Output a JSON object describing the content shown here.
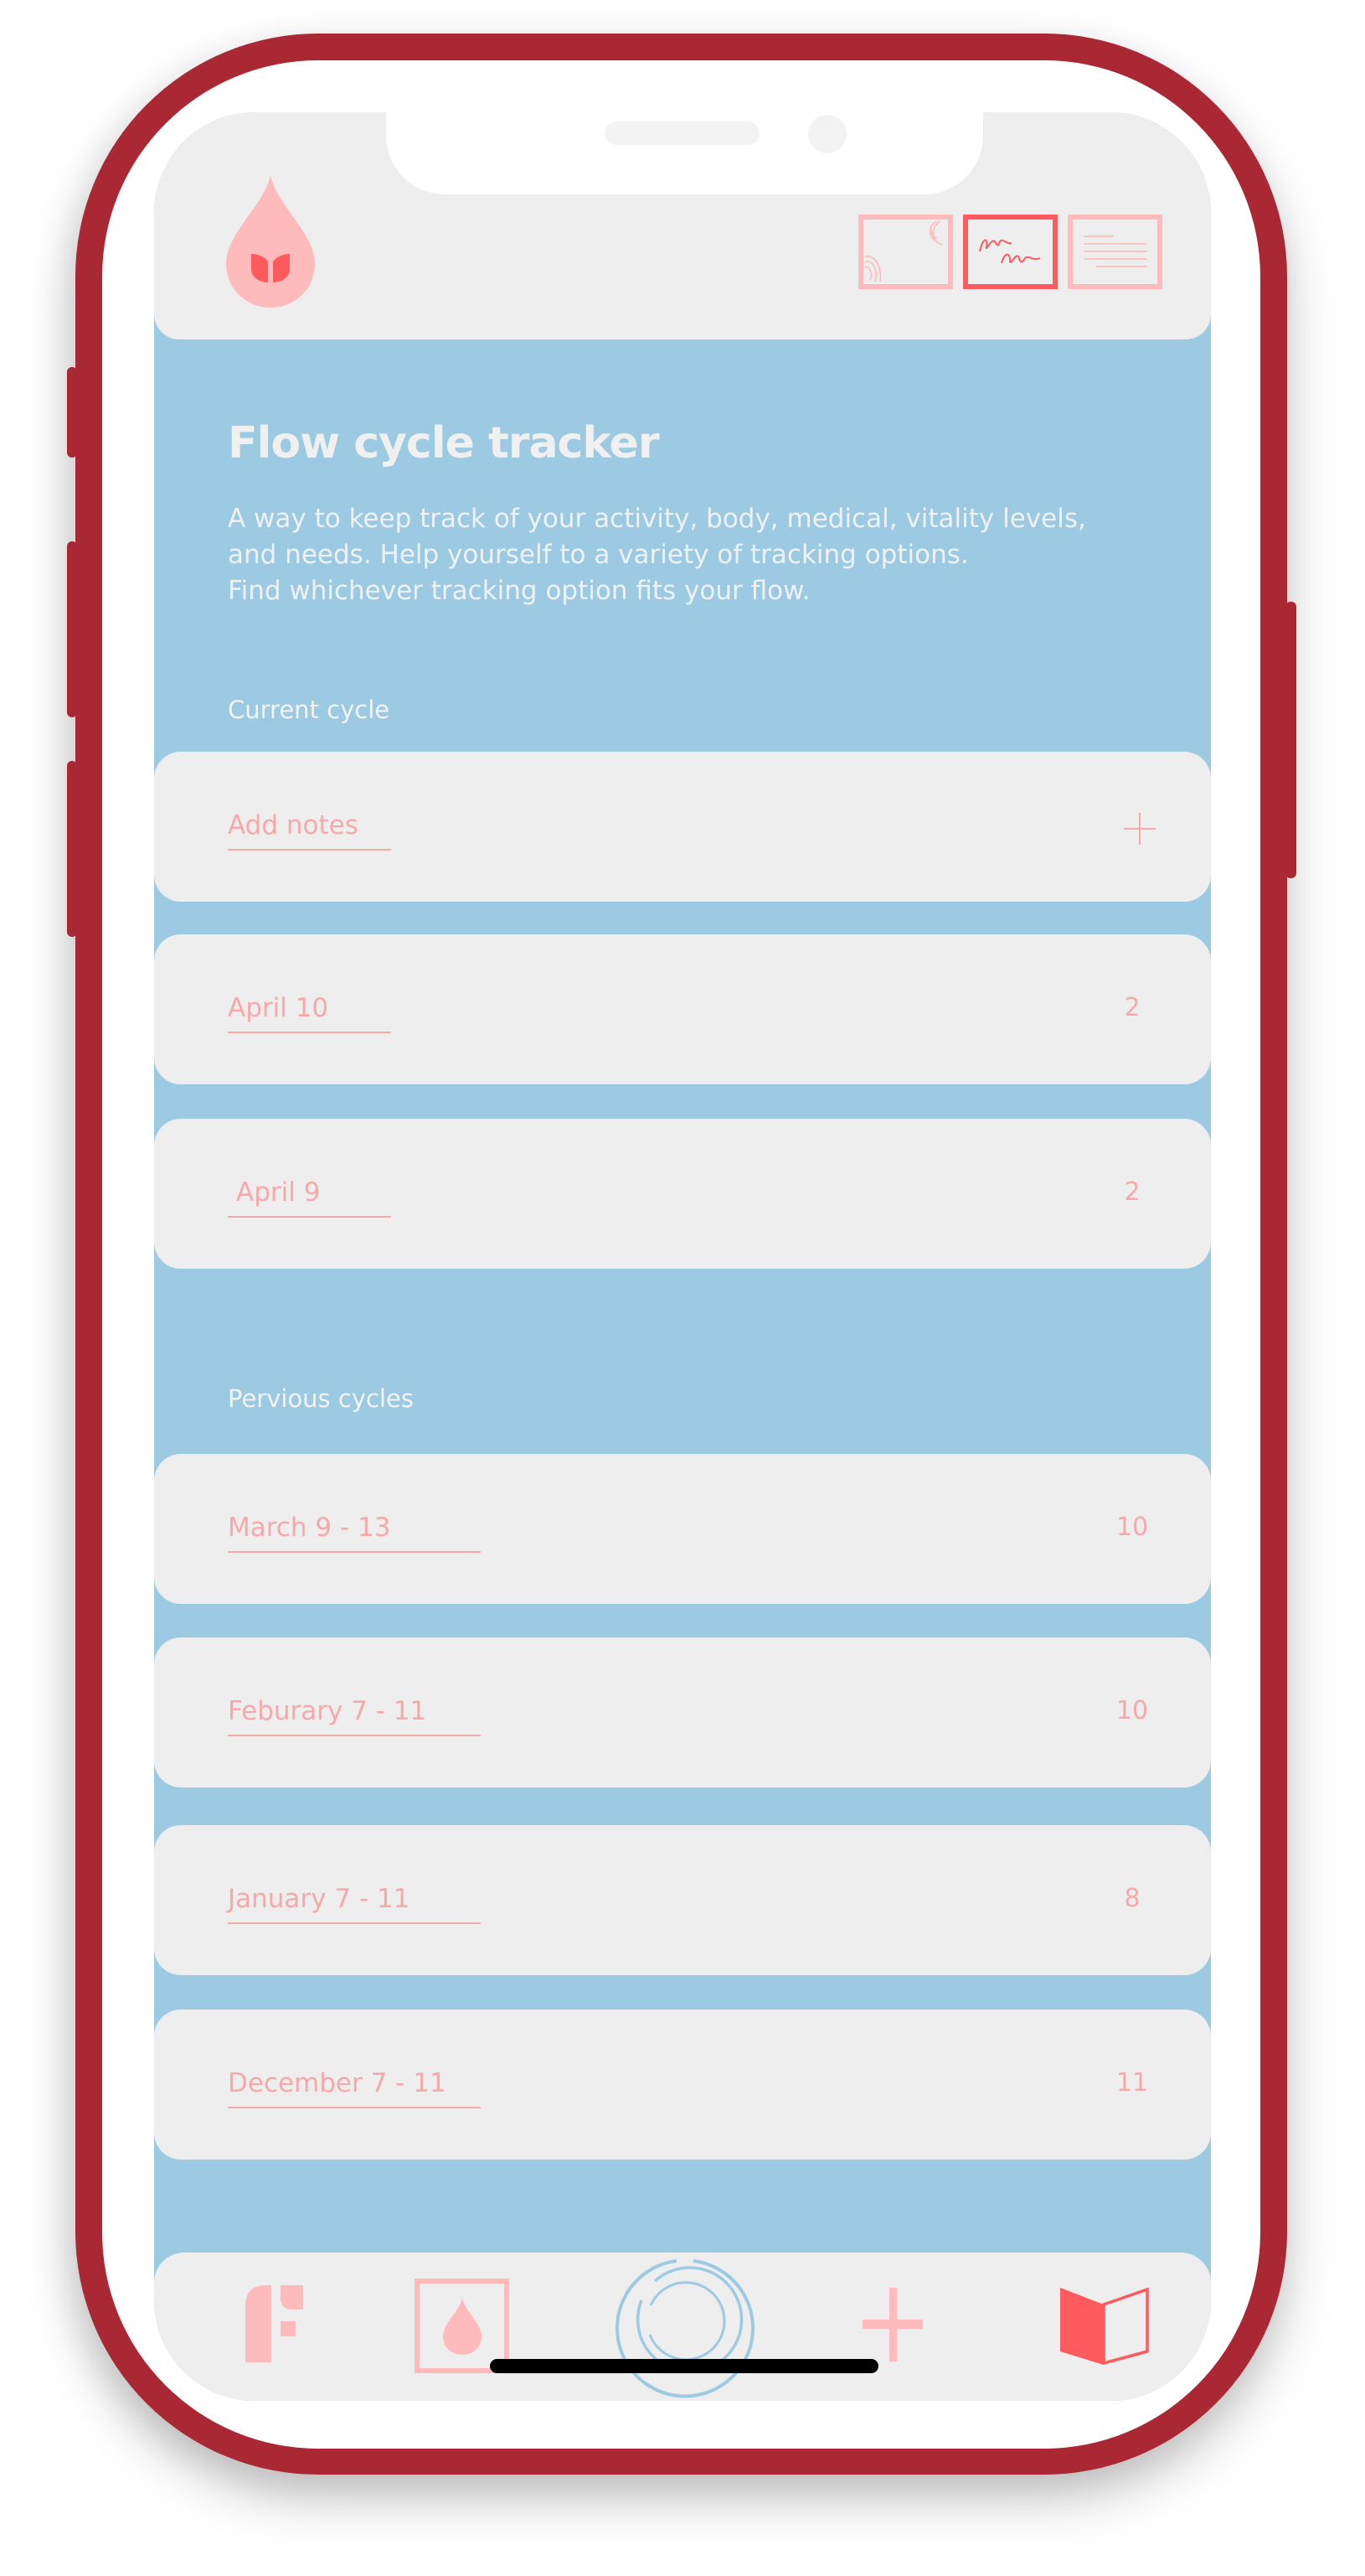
{
  "app": {
    "title": "Flow cycle tracker",
    "description_lines": [
      "A way to keep track of your activity, body, medical, vitality levels,",
      "and needs. Help yourself to a variety of tracking options.",
      "Find whichever tracking option fits your flow."
    ]
  },
  "header": {
    "logo": "blood-drop-logo",
    "view_toggles": [
      {
        "name": "wave-view",
        "icon": "sound-waves-icon",
        "active": false
      },
      {
        "name": "scribble-view",
        "icon": "scribble-icon",
        "active": true
      },
      {
        "name": "list-view",
        "icon": "text-lines-icon",
        "active": false
      }
    ]
  },
  "current_cycle": {
    "label": "Current cycle",
    "add_notes": {
      "label": "Add notes",
      "icon": "plus-icon"
    },
    "entries": [
      {
        "label": "April 10",
        "value": "2"
      },
      {
        "label": "April 9",
        "value": "2"
      }
    ]
  },
  "previous_cycles": {
    "label": "Pervious cycles",
    "entries": [
      {
        "label": "March 9 - 13",
        "value": "10"
      },
      {
        "label": "Feburary 7 - 11",
        "value": "10"
      },
      {
        "label": "January 7 - 11",
        "value": "8"
      },
      {
        "label": "December 7 - 11",
        "value": "11"
      }
    ]
  },
  "bottom_nav": [
    {
      "name": "flow-home",
      "icon": "f-logo-icon"
    },
    {
      "name": "tracker",
      "icon": "drop-box-icon"
    },
    {
      "name": "cycle-ring",
      "icon": "concentric-rings-icon"
    },
    {
      "name": "add",
      "icon": "plus-icon"
    },
    {
      "name": "journal",
      "icon": "open-book-icon"
    }
  ],
  "colors": {
    "frame": "#aa2734",
    "screen_bg": "#9ccae3",
    "card_bg": "#eeeeee",
    "accent_light": "#ffbbbb",
    "accent": "#ff5a5e",
    "text_pink": "#f6a9a9",
    "ring_blue": "#9ccae3"
  }
}
